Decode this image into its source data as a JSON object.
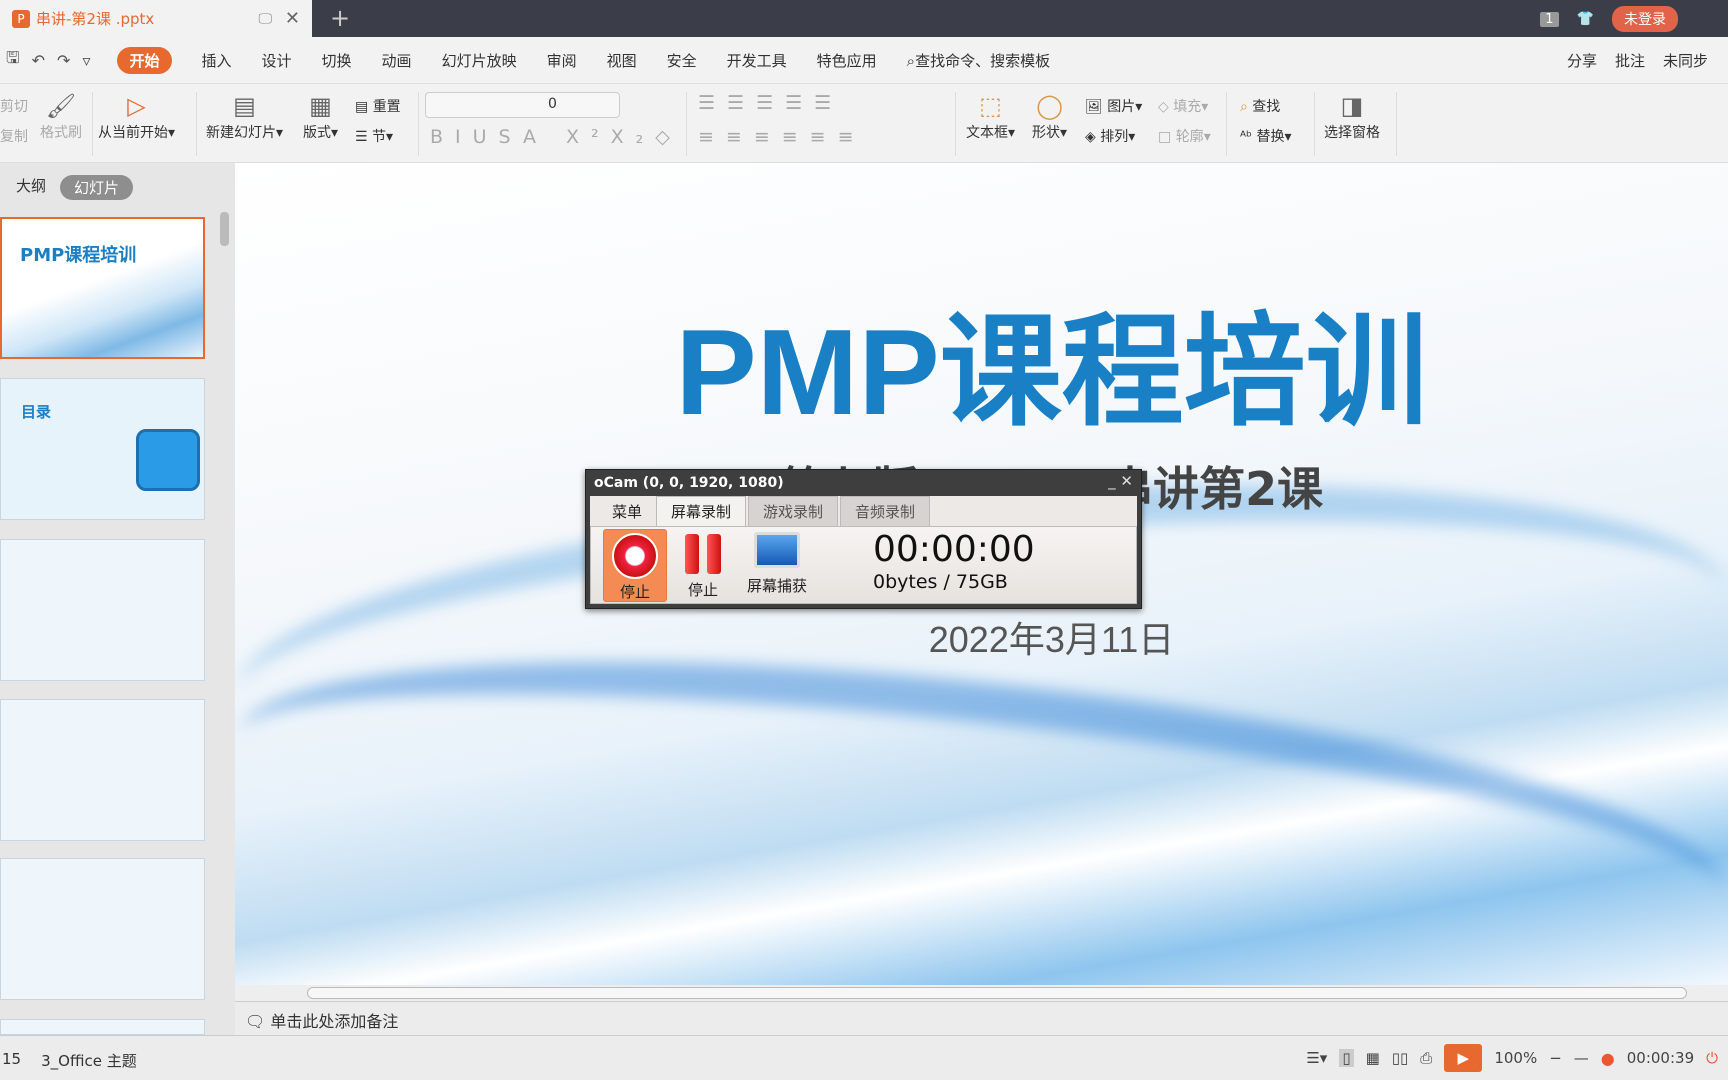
{
  "titlebar": {
    "doc_name": "串讲-第2课 .pptx",
    "login": "未登录",
    "window_count": "1"
  },
  "menu": {
    "items": [
      "开始",
      "插入",
      "设计",
      "切换",
      "动画",
      "幻灯片放映",
      "审阅",
      "视图",
      "安全",
      "开发工具",
      "特色应用"
    ],
    "search": "查找命令、搜索模板",
    "right": [
      "分享",
      "批注",
      "未同步"
    ]
  },
  "ribbon": {
    "cut": "剪切",
    "copy": "复制",
    "format_painter": "格式刷",
    "play_from_current": "从当前开始",
    "new_slide": "新建幻灯片",
    "layout": "版式",
    "reset": "重置",
    "section": "节",
    "font_size": "0",
    "textbox": "文本框",
    "shape": "形状",
    "picture": "图片",
    "fill": "填充",
    "arrange": "排列",
    "outline": "轮廓",
    "find": "查找",
    "replace": "替换",
    "selection_pane": "选择窗格"
  },
  "panel": {
    "tabs": [
      "大纲",
      "幻灯片"
    ],
    "thumbs": [
      {
        "title": "PMP课程培训"
      },
      {
        "title": "目录"
      },
      {
        "title": ""
      },
      {
        "title": ""
      },
      {
        "title": ""
      },
      {
        "title": ""
      }
    ]
  },
  "slide": {
    "title": "PMP课程培训",
    "subtitle": "第七版PMBOK串讲第2课",
    "date": "2022年3月11日",
    "title_color": "#1a80c6"
  },
  "notes": {
    "placeholder": "单击此处添加备注"
  },
  "status": {
    "slide_num": "15",
    "theme": "3_Office 主题",
    "zoom": "100%",
    "rec_time": "00:00:39"
  },
  "ocam": {
    "title": "oCam (0, 0, 1920, 1080)",
    "tabs": [
      "菜单",
      "屏幕录制",
      "游戏录制",
      "音频录制"
    ],
    "buttons": [
      "停止",
      "停止",
      "屏幕捕获"
    ],
    "time": "00:00:00",
    "size": "0bytes / 75GB"
  }
}
